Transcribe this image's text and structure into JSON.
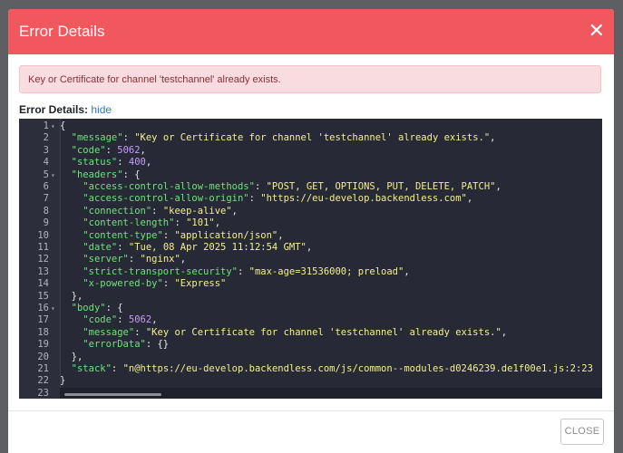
{
  "modal": {
    "title": "Error Details",
    "close_icon": "✕",
    "alert_text": "Key or Certificate for channel 'testchannel' already exists.",
    "details_label": "Error Details:",
    "hide_link": "hide",
    "footer_button": "CLOSE"
  },
  "code": {
    "lines": [
      {
        "n": "1",
        "fold": "▾",
        "parts": [
          [
            "p",
            "{"
          ]
        ]
      },
      {
        "n": "2",
        "parts": [
          [
            "p",
            "  "
          ],
          [
            "k",
            "\"message\""
          ],
          [
            "p",
            ": "
          ],
          [
            "s",
            "\"Key or Certificate for channel 'testchannel' already exists.\""
          ],
          [
            "p",
            ","
          ]
        ]
      },
      {
        "n": "3",
        "parts": [
          [
            "p",
            "  "
          ],
          [
            "k",
            "\"code\""
          ],
          [
            "p",
            ": "
          ],
          [
            "n",
            "5062"
          ],
          [
            "p",
            ","
          ]
        ]
      },
      {
        "n": "4",
        "parts": [
          [
            "p",
            "  "
          ],
          [
            "k",
            "\"status\""
          ],
          [
            "p",
            ": "
          ],
          [
            "n",
            "400"
          ],
          [
            "p",
            ","
          ]
        ]
      },
      {
        "n": "5",
        "fold": "▾",
        "parts": [
          [
            "p",
            "  "
          ],
          [
            "k",
            "\"headers\""
          ],
          [
            "p",
            ": {"
          ]
        ]
      },
      {
        "n": "6",
        "parts": [
          [
            "p",
            "    "
          ],
          [
            "k",
            "\"access-control-allow-methods\""
          ],
          [
            "p",
            ": "
          ],
          [
            "s",
            "\"POST, GET, OPTIONS, PUT, DELETE, PATCH\""
          ],
          [
            "p",
            ","
          ]
        ]
      },
      {
        "n": "7",
        "parts": [
          [
            "p",
            "    "
          ],
          [
            "k",
            "\"access-control-allow-origin\""
          ],
          [
            "p",
            ": "
          ],
          [
            "s",
            "\"https://eu-develop.backendless.com\""
          ],
          [
            "p",
            ","
          ]
        ]
      },
      {
        "n": "8",
        "parts": [
          [
            "p",
            "    "
          ],
          [
            "k",
            "\"connection\""
          ],
          [
            "p",
            ": "
          ],
          [
            "s",
            "\"keep-alive\""
          ],
          [
            "p",
            ","
          ]
        ]
      },
      {
        "n": "9",
        "parts": [
          [
            "p",
            "    "
          ],
          [
            "k",
            "\"content-length\""
          ],
          [
            "p",
            ": "
          ],
          [
            "s",
            "\"101\""
          ],
          [
            "p",
            ","
          ]
        ]
      },
      {
        "n": "10",
        "parts": [
          [
            "p",
            "    "
          ],
          [
            "k",
            "\"content-type\""
          ],
          [
            "p",
            ": "
          ],
          [
            "s",
            "\"application/json\""
          ],
          [
            "p",
            ","
          ]
        ]
      },
      {
        "n": "11",
        "parts": [
          [
            "p",
            "    "
          ],
          [
            "k",
            "\"date\""
          ],
          [
            "p",
            ": "
          ],
          [
            "s",
            "\"Tue, 08 Apr 2025 11:12:54 GMT\""
          ],
          [
            "p",
            ","
          ]
        ]
      },
      {
        "n": "12",
        "parts": [
          [
            "p",
            "    "
          ],
          [
            "k",
            "\"server\""
          ],
          [
            "p",
            ": "
          ],
          [
            "s",
            "\"nginx\""
          ],
          [
            "p",
            ","
          ]
        ]
      },
      {
        "n": "13",
        "parts": [
          [
            "p",
            "    "
          ],
          [
            "k",
            "\"strict-transport-security\""
          ],
          [
            "p",
            ": "
          ],
          [
            "s",
            "\"max-age=31536000; preload\""
          ],
          [
            "p",
            ","
          ]
        ]
      },
      {
        "n": "14",
        "parts": [
          [
            "p",
            "    "
          ],
          [
            "k",
            "\"x-powered-by\""
          ],
          [
            "p",
            ": "
          ],
          [
            "s",
            "\"Express\""
          ]
        ]
      },
      {
        "n": "15",
        "parts": [
          [
            "p",
            "  },"
          ]
        ]
      },
      {
        "n": "16",
        "fold": "▾",
        "parts": [
          [
            "p",
            "  "
          ],
          [
            "k",
            "\"body\""
          ],
          [
            "p",
            ": {"
          ]
        ]
      },
      {
        "n": "17",
        "parts": [
          [
            "p",
            "    "
          ],
          [
            "k",
            "\"code\""
          ],
          [
            "p",
            ": "
          ],
          [
            "n",
            "5062"
          ],
          [
            "p",
            ","
          ]
        ]
      },
      {
        "n": "18",
        "parts": [
          [
            "p",
            "    "
          ],
          [
            "k",
            "\"message\""
          ],
          [
            "p",
            ": "
          ],
          [
            "s",
            "\"Key or Certificate for channel 'testchannel' already exists.\""
          ],
          [
            "p",
            ","
          ]
        ]
      },
      {
        "n": "19",
        "parts": [
          [
            "p",
            "    "
          ],
          [
            "k",
            "\"errorData\""
          ],
          [
            "p",
            ": {}"
          ]
        ]
      },
      {
        "n": "20",
        "parts": [
          [
            "p",
            "  },"
          ]
        ]
      },
      {
        "n": "21",
        "parts": [
          [
            "p",
            "  "
          ],
          [
            "k",
            "\"stack\""
          ],
          [
            "p",
            ": "
          ],
          [
            "s",
            "\"n@https://eu-develop.backendless.com/js/common--modules-d0246239.de1f00e1.js:2:23"
          ]
        ]
      },
      {
        "n": "22",
        "parts": [
          [
            "p",
            "}"
          ]
        ]
      },
      {
        "n": "23",
        "parts": [
          [
            "p",
            ""
          ]
        ]
      }
    ]
  }
}
